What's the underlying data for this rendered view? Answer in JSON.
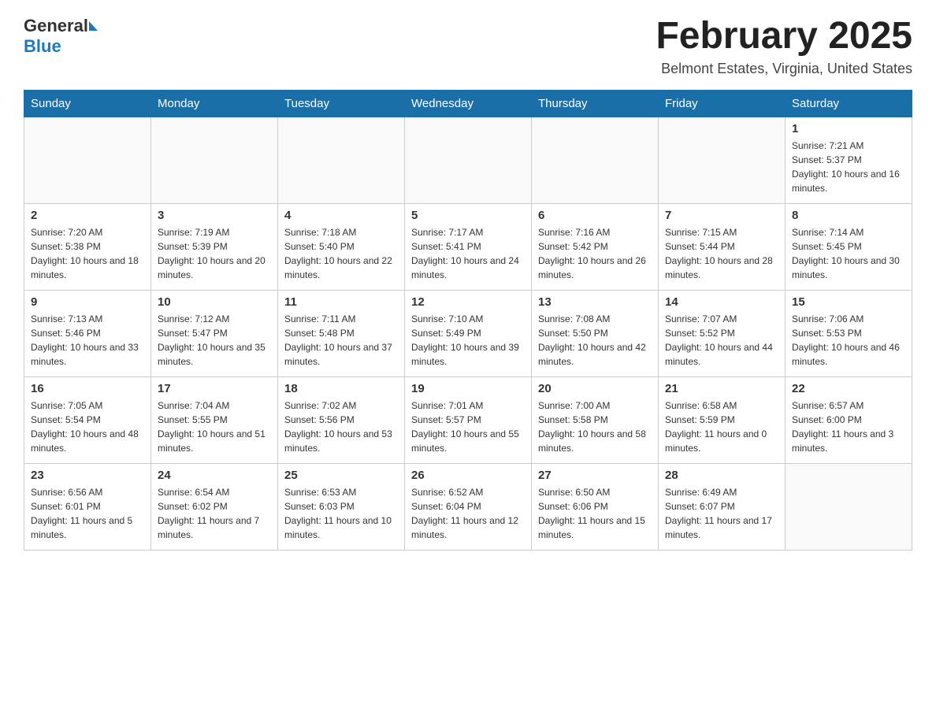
{
  "header": {
    "logo_general": "General",
    "logo_blue": "Blue",
    "month_title": "February 2025",
    "location": "Belmont Estates, Virginia, United States"
  },
  "calendar": {
    "days_of_week": [
      "Sunday",
      "Monday",
      "Tuesday",
      "Wednesday",
      "Thursday",
      "Friday",
      "Saturday"
    ],
    "weeks": [
      [
        {
          "day": "",
          "info": ""
        },
        {
          "day": "",
          "info": ""
        },
        {
          "day": "",
          "info": ""
        },
        {
          "day": "",
          "info": ""
        },
        {
          "day": "",
          "info": ""
        },
        {
          "day": "",
          "info": ""
        },
        {
          "day": "1",
          "info": "Sunrise: 7:21 AM\nSunset: 5:37 PM\nDaylight: 10 hours and 16 minutes."
        }
      ],
      [
        {
          "day": "2",
          "info": "Sunrise: 7:20 AM\nSunset: 5:38 PM\nDaylight: 10 hours and 18 minutes."
        },
        {
          "day": "3",
          "info": "Sunrise: 7:19 AM\nSunset: 5:39 PM\nDaylight: 10 hours and 20 minutes."
        },
        {
          "day": "4",
          "info": "Sunrise: 7:18 AM\nSunset: 5:40 PM\nDaylight: 10 hours and 22 minutes."
        },
        {
          "day": "5",
          "info": "Sunrise: 7:17 AM\nSunset: 5:41 PM\nDaylight: 10 hours and 24 minutes."
        },
        {
          "day": "6",
          "info": "Sunrise: 7:16 AM\nSunset: 5:42 PM\nDaylight: 10 hours and 26 minutes."
        },
        {
          "day": "7",
          "info": "Sunrise: 7:15 AM\nSunset: 5:44 PM\nDaylight: 10 hours and 28 minutes."
        },
        {
          "day": "8",
          "info": "Sunrise: 7:14 AM\nSunset: 5:45 PM\nDaylight: 10 hours and 30 minutes."
        }
      ],
      [
        {
          "day": "9",
          "info": "Sunrise: 7:13 AM\nSunset: 5:46 PM\nDaylight: 10 hours and 33 minutes."
        },
        {
          "day": "10",
          "info": "Sunrise: 7:12 AM\nSunset: 5:47 PM\nDaylight: 10 hours and 35 minutes."
        },
        {
          "day": "11",
          "info": "Sunrise: 7:11 AM\nSunset: 5:48 PM\nDaylight: 10 hours and 37 minutes."
        },
        {
          "day": "12",
          "info": "Sunrise: 7:10 AM\nSunset: 5:49 PM\nDaylight: 10 hours and 39 minutes."
        },
        {
          "day": "13",
          "info": "Sunrise: 7:08 AM\nSunset: 5:50 PM\nDaylight: 10 hours and 42 minutes."
        },
        {
          "day": "14",
          "info": "Sunrise: 7:07 AM\nSunset: 5:52 PM\nDaylight: 10 hours and 44 minutes."
        },
        {
          "day": "15",
          "info": "Sunrise: 7:06 AM\nSunset: 5:53 PM\nDaylight: 10 hours and 46 minutes."
        }
      ],
      [
        {
          "day": "16",
          "info": "Sunrise: 7:05 AM\nSunset: 5:54 PM\nDaylight: 10 hours and 48 minutes."
        },
        {
          "day": "17",
          "info": "Sunrise: 7:04 AM\nSunset: 5:55 PM\nDaylight: 10 hours and 51 minutes."
        },
        {
          "day": "18",
          "info": "Sunrise: 7:02 AM\nSunset: 5:56 PM\nDaylight: 10 hours and 53 minutes."
        },
        {
          "day": "19",
          "info": "Sunrise: 7:01 AM\nSunset: 5:57 PM\nDaylight: 10 hours and 55 minutes."
        },
        {
          "day": "20",
          "info": "Sunrise: 7:00 AM\nSunset: 5:58 PM\nDaylight: 10 hours and 58 minutes."
        },
        {
          "day": "21",
          "info": "Sunrise: 6:58 AM\nSunset: 5:59 PM\nDaylight: 11 hours and 0 minutes."
        },
        {
          "day": "22",
          "info": "Sunrise: 6:57 AM\nSunset: 6:00 PM\nDaylight: 11 hours and 3 minutes."
        }
      ],
      [
        {
          "day": "23",
          "info": "Sunrise: 6:56 AM\nSunset: 6:01 PM\nDaylight: 11 hours and 5 minutes."
        },
        {
          "day": "24",
          "info": "Sunrise: 6:54 AM\nSunset: 6:02 PM\nDaylight: 11 hours and 7 minutes."
        },
        {
          "day": "25",
          "info": "Sunrise: 6:53 AM\nSunset: 6:03 PM\nDaylight: 11 hours and 10 minutes."
        },
        {
          "day": "26",
          "info": "Sunrise: 6:52 AM\nSunset: 6:04 PM\nDaylight: 11 hours and 12 minutes."
        },
        {
          "day": "27",
          "info": "Sunrise: 6:50 AM\nSunset: 6:06 PM\nDaylight: 11 hours and 15 minutes."
        },
        {
          "day": "28",
          "info": "Sunrise: 6:49 AM\nSunset: 6:07 PM\nDaylight: 11 hours and 17 minutes."
        },
        {
          "day": "",
          "info": ""
        }
      ]
    ]
  }
}
